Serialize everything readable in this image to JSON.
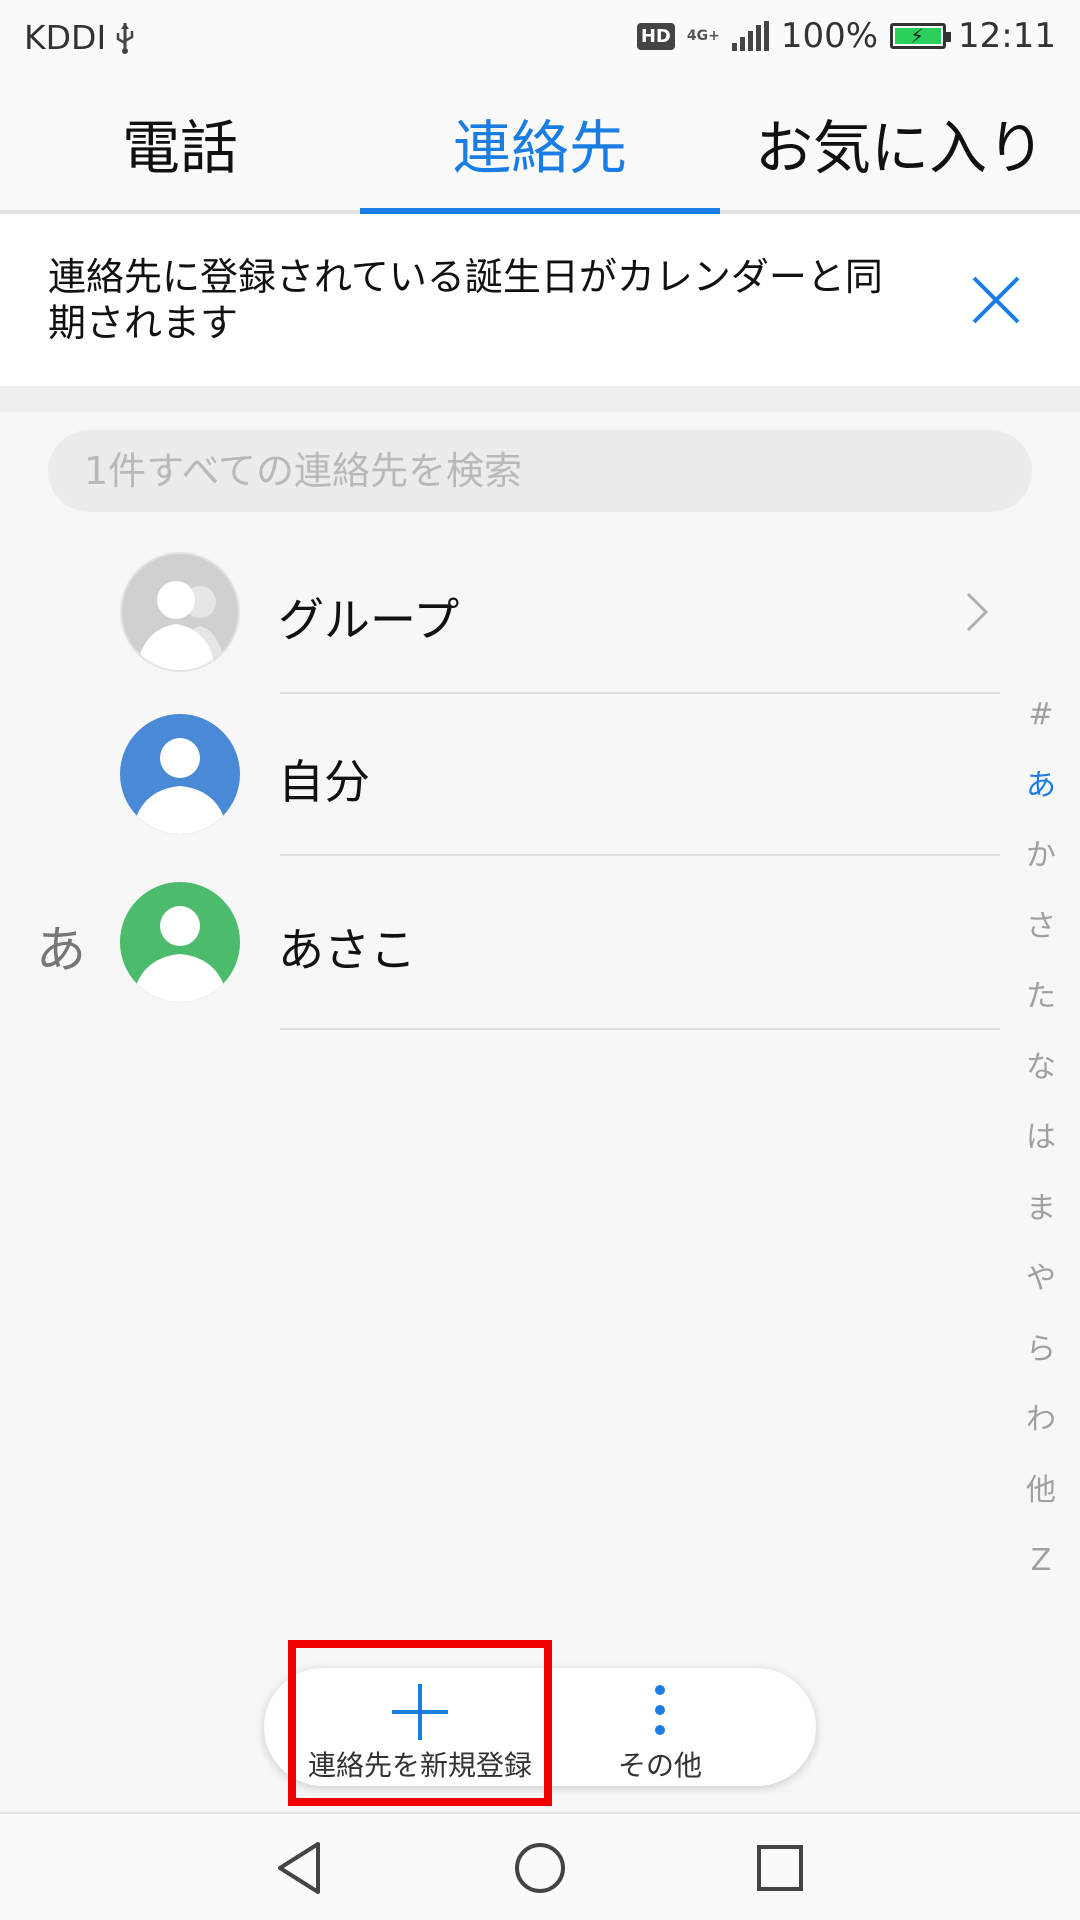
{
  "status_bar": {
    "carrier": "KDDI",
    "hd": "HD",
    "network": "4G+",
    "battery": "100%",
    "time": "12:11"
  },
  "tabs": [
    {
      "label": "電話",
      "active": false
    },
    {
      "label": "連絡先",
      "active": true
    },
    {
      "label": "お気に入り",
      "active": false
    }
  ],
  "banner": {
    "text": "連絡先に登録されている誕生日がカレンダーと同期されます"
  },
  "search": {
    "placeholder": "1件すべての連絡先を検索"
  },
  "list": {
    "groups_label": "グループ",
    "me_label": "自分",
    "section_letter": "あ",
    "contact_name": "あさこ"
  },
  "index_bar": [
    "#",
    "あ",
    "か",
    "さ",
    "た",
    "な",
    "は",
    "ま",
    "や",
    "ら",
    "わ",
    "他",
    "Z"
  ],
  "index_active": "あ",
  "actions": {
    "new_contact": "連絡先を新規登録",
    "more": "その他"
  },
  "colors": {
    "accent": "#1a7de4",
    "me_avatar": "#4a89d6",
    "contact_avatar": "#4cbb6c",
    "group_avatar": "#cfcfcf",
    "highlight": "#ee0000"
  },
  "icons": {
    "usb": "usb-icon",
    "close": "close-icon",
    "add": "plus-icon",
    "more": "more-vertical-icon",
    "back": "back-triangle-icon",
    "home": "home-circle-icon",
    "recents": "recents-square-icon"
  }
}
